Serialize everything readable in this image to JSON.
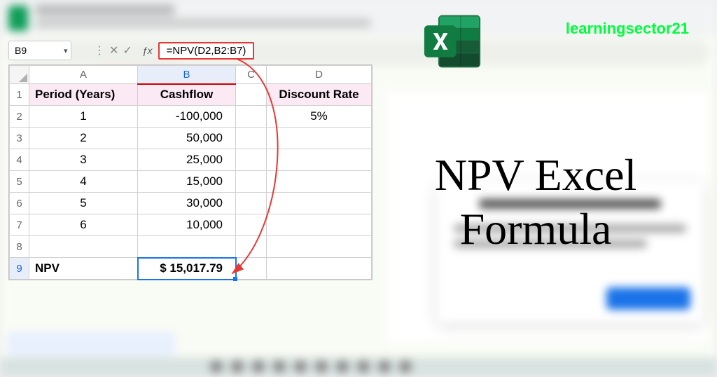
{
  "watermark": "learningsector21",
  "big_title_line1": "NPV Excel",
  "big_title_line2": "Formula",
  "name_box": {
    "value": "B9"
  },
  "formula_bar": {
    "formula": "=NPV(D2,B2:B7)"
  },
  "sheet": {
    "column_headers": [
      "A",
      "B",
      "C",
      "D"
    ],
    "row_headers": [
      "1",
      "2",
      "3",
      "4",
      "5",
      "6",
      "7",
      "8",
      "9"
    ],
    "headers": {
      "A1": "Period (Years)",
      "B1": "Cashflow",
      "D1": "Discount Rate"
    },
    "data": {
      "A2": "1",
      "B2": "-100,000",
      "D2": "5%",
      "A3": "2",
      "B3": "50,000",
      "A4": "3",
      "B4": "25,000",
      "A5": "4",
      "B5": "15,000",
      "A6": "5",
      "B6": "30,000",
      "A7": "6",
      "B7": "10,000",
      "A9": "NPV",
      "B9": "$ 15,017.79"
    }
  }
}
